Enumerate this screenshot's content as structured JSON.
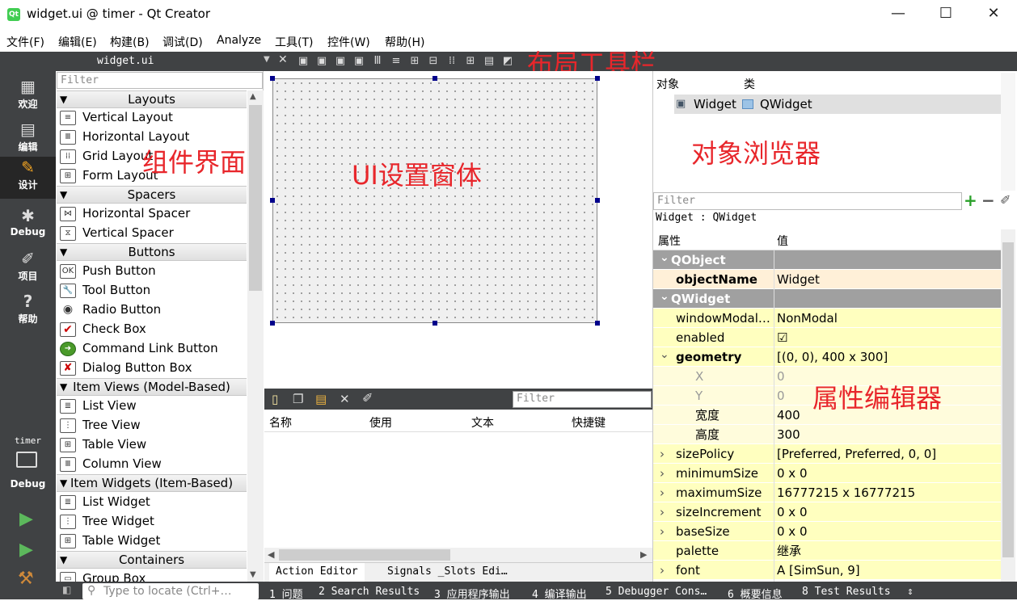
{
  "window": {
    "title": "widget.ui @ timer - Qt Creator",
    "minimize": "—",
    "maximize": "☐",
    "close": "✕"
  },
  "menubar": [
    "文件(F)",
    "编辑(E)",
    "构建(B)",
    "调试(D)",
    "Analyze",
    "工具(T)",
    "控件(W)",
    "帮助(H)"
  ],
  "modes": [
    {
      "label": "欢迎",
      "icon": "grid-icon"
    },
    {
      "label": "编辑",
      "icon": "document-icon"
    },
    {
      "label": "设计",
      "icon": "pencil-icon"
    },
    {
      "label": "Debug",
      "icon": "bug-icon"
    },
    {
      "label": "项目",
      "icon": "wrench-icon"
    },
    {
      "label": "帮助",
      "icon": "help-icon"
    }
  ],
  "target": {
    "project": "timer",
    "config": "Debug"
  },
  "editor": {
    "tab": "widget.ui",
    "close": "✕"
  },
  "widget_box": {
    "filter_placeholder": "Filter",
    "categories": [
      {
        "name": "Layouts",
        "items": [
          "Vertical Layout",
          "Horizontal Layout",
          "Grid Layout",
          "Form Layout"
        ]
      },
      {
        "name": "Spacers",
        "items": [
          "Horizontal Spacer",
          "Vertical Spacer"
        ]
      },
      {
        "name": "Buttons",
        "items": [
          "Push Button",
          "Tool Button",
          "Radio Button",
          "Check Box",
          "Command Link Button",
          "Dialog Button Box"
        ]
      },
      {
        "name": "Item Views (Model-Based)",
        "items": [
          "List View",
          "Tree View",
          "Table View",
          "Column View"
        ]
      },
      {
        "name": "Item Widgets (Item-Based)",
        "items": [
          "List Widget",
          "Tree Widget",
          "Table Widget"
        ]
      },
      {
        "name": "Containers",
        "items": [
          "Group Box"
        ]
      }
    ]
  },
  "action_editor": {
    "filter_placeholder": "Filter",
    "columns": [
      "名称",
      "使用",
      "文本",
      "快捷键"
    ],
    "tabs": [
      "Action Editor",
      "Signals _Slots Edi…"
    ]
  },
  "object_inspector": {
    "columns": [
      "对象",
      "类"
    ],
    "rows": [
      {
        "object": "Widget",
        "class": "QWidget"
      }
    ]
  },
  "property_editor": {
    "filter_placeholder": "Filter",
    "class_line": "Widget : QWidget",
    "columns": [
      "属性",
      "值"
    ],
    "rows": [
      {
        "type": "group",
        "name": "QObject"
      },
      {
        "type": "sel",
        "name": "objectName",
        "value": "Widget",
        "bold": true
      },
      {
        "type": "group",
        "name": "QWidget"
      },
      {
        "type": "yl",
        "name": "windowModal…",
        "value": "NonModal"
      },
      {
        "type": "yl",
        "name": "enabled",
        "value": "☑"
      },
      {
        "type": "yl",
        "name": "geometry",
        "value": "[(0, 0), 400 x 300]",
        "bold": true,
        "expanded": true
      },
      {
        "type": "yl2",
        "name": "X",
        "value": "0",
        "indent": true,
        "muted": true
      },
      {
        "type": "yl2",
        "name": "Y",
        "value": "0",
        "indent": true,
        "muted": true
      },
      {
        "type": "yl2",
        "name": "宽度",
        "value": "400",
        "indent": true
      },
      {
        "type": "yl2",
        "name": "高度",
        "value": "300",
        "indent": true
      },
      {
        "type": "yl",
        "name": "sizePolicy",
        "value": "[Preferred, Preferred, 0, 0]",
        "collapsed": true
      },
      {
        "type": "yl",
        "name": "minimumSize",
        "value": "0 x 0",
        "collapsed": true
      },
      {
        "type": "yl",
        "name": "maximumSize",
        "value": "16777215 x 16777215",
        "collapsed": true
      },
      {
        "type": "yl",
        "name": "sizeIncrement",
        "value": "0 x 0",
        "collapsed": true
      },
      {
        "type": "yl",
        "name": "baseSize",
        "value": "0 x 0",
        "collapsed": true
      },
      {
        "type": "yl",
        "name": "palette",
        "value": "继承"
      },
      {
        "type": "yl",
        "name": "font",
        "value": "A  [SimSun, 9]",
        "collapsed": true
      }
    ]
  },
  "status": {
    "locate_placeholder": "Type to locate (Ctrl+…",
    "panes": [
      "1 问题",
      "2 Search Results",
      "3 应用程序输出",
      "4 编译输出",
      "5 Debugger Cons…",
      "6 概要信息",
      "8 Test Results"
    ]
  },
  "annotations": {
    "toolbar": "布局工具栏",
    "widgets": "组件界面",
    "form": "UI设置窗体",
    "objects": "对象浏览器",
    "properties": "属性编辑器"
  }
}
